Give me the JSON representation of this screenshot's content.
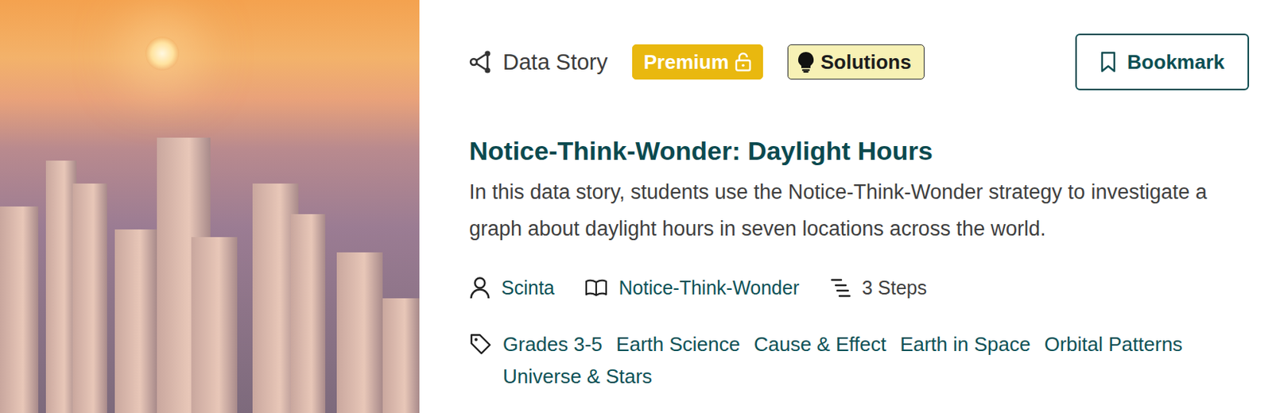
{
  "type": {
    "label": "Data Story"
  },
  "badges": [
    {
      "label": "Premium",
      "kind": "premium"
    },
    {
      "label": "Solutions",
      "kind": "solutions"
    }
  ],
  "bookmark": {
    "label": "Bookmark"
  },
  "title": "Notice-Think-Wonder: Daylight Hours",
  "description": "In this data story, students use the Notice-Think-Wonder strategy to investigate a graph about daylight hours in seven locations across the world.",
  "meta": [
    {
      "label": "Scinta",
      "kind": "author"
    },
    {
      "label": "Notice-Think-Wonder",
      "kind": "collection"
    },
    {
      "label": "3 Steps",
      "kind": "steps"
    }
  ],
  "tags": [
    "Grades 3-5",
    "Earth Science",
    "Cause & Effect",
    "Earth in Space",
    "Orbital Patterns",
    "Universe & Stars"
  ]
}
